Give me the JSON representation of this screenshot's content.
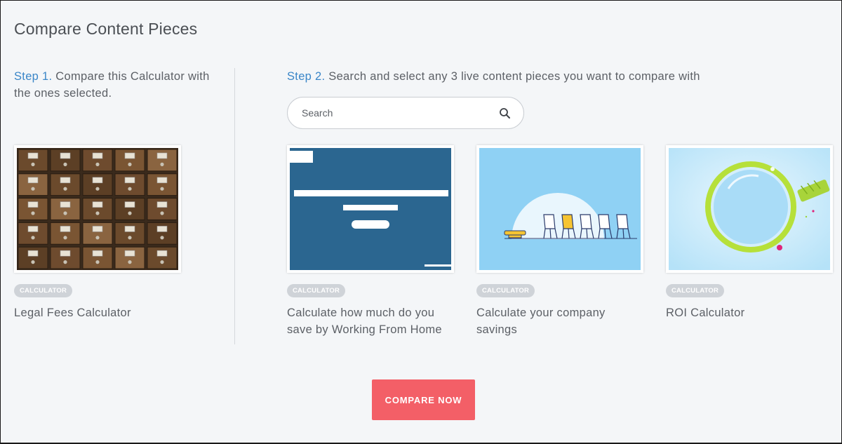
{
  "page": {
    "title": "Compare Content Pieces"
  },
  "step1": {
    "label": "Step 1.",
    "text": " Compare this Calculator with the ones selected."
  },
  "step2": {
    "label": "Step 2.",
    "text": " Search and select any 3 live content pieces you want to compare with",
    "search_placeholder": "Search"
  },
  "selected": {
    "badge": "CALCULATOR",
    "title": "Legal Fees Calculator",
    "image": "card-catalog-drawers-photo"
  },
  "options": [
    {
      "badge": "CALCULATOR",
      "title": "Calculate how much do you save by Working From Home",
      "image": "blue-template-placeholder"
    },
    {
      "badge": "CALCULATOR",
      "title": "Calculate your company savings",
      "image": "chairs-row-illustration"
    },
    {
      "badge": "CALCULATOR",
      "title": "ROI Calculator",
      "image": "magnifying-glass-illustration"
    }
  ],
  "actions": {
    "compare_label": "COMPARE NOW"
  },
  "colors": {
    "background": "#f4f6f8",
    "accent_blue": "#3a86c8",
    "compare_button": "#f35f67",
    "badge": "#cfd3d8",
    "text": "#5c6066"
  }
}
